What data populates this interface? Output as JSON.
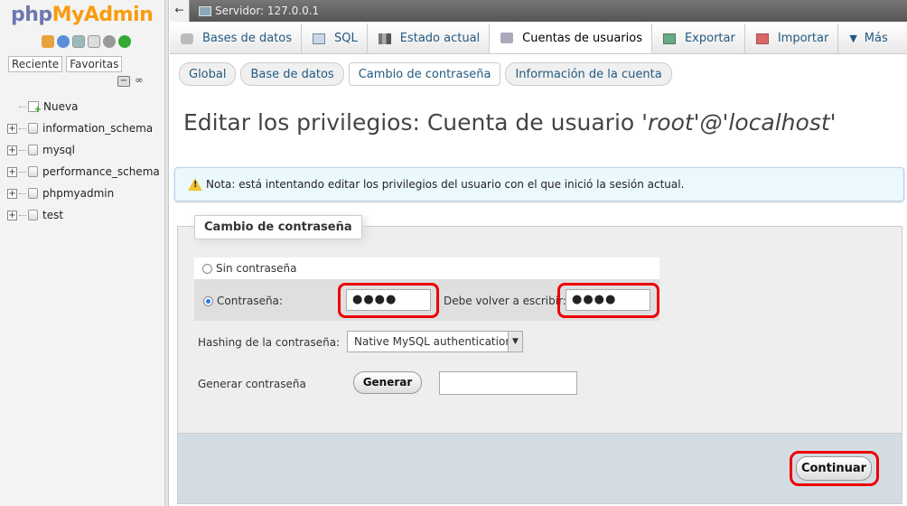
{
  "brand": {
    "php": "php",
    "my": "My",
    "admin": "Admin"
  },
  "left_tabs": [
    "Reciente",
    "Favoritas"
  ],
  "tree": {
    "new_label": "Nueva",
    "databases": [
      "information_schema",
      "mysql",
      "performance_schema",
      "phpmyadmin",
      "test"
    ]
  },
  "server_bar": {
    "back": "←",
    "title": "Servidor: 127.0.0.1"
  },
  "top_menu": {
    "items": [
      {
        "label": "Bases de datos",
        "icon": "database-icon"
      },
      {
        "label": "SQL",
        "icon": "sql-icon"
      },
      {
        "label": "Estado actual",
        "icon": "status-icon"
      },
      {
        "label": "Cuentas de usuarios",
        "icon": "users-icon"
      },
      {
        "label": "Exportar",
        "icon": "export-icon"
      },
      {
        "label": "Importar",
        "icon": "import-icon"
      },
      {
        "label": "Más",
        "icon": "dropdown-icon"
      }
    ],
    "active_index": 3
  },
  "sub_tabs": [
    "Global",
    "Base de datos",
    "Cambio de contraseña",
    "Información de la cuenta"
  ],
  "page": {
    "title_prefix": "Editar los privilegios: Cuenta de usuario ",
    "title_user": "'root'@'localhost'",
    "notice": "Nota: está intentando editar los privilegios del usuario con el que inició la sesión actual."
  },
  "form": {
    "legend": "Cambio de contraseña",
    "no_password": "Sin contraseña",
    "password": "Contraseña:",
    "password_value": "●●●●",
    "retype": "Debe volver a escribir:",
    "retype_value": "●●●●",
    "hashing_label": "Hashing de la contraseña:",
    "hashing_value": "Native MySQL authentication",
    "generate_label": "Generar contraseña",
    "generate_button": "Generar",
    "generated_value": "",
    "submit": "Continuar"
  },
  "colors": {
    "highlight": "#e00000",
    "brand_orange": "#f89c0e",
    "brand_blue": "#6c78af"
  }
}
